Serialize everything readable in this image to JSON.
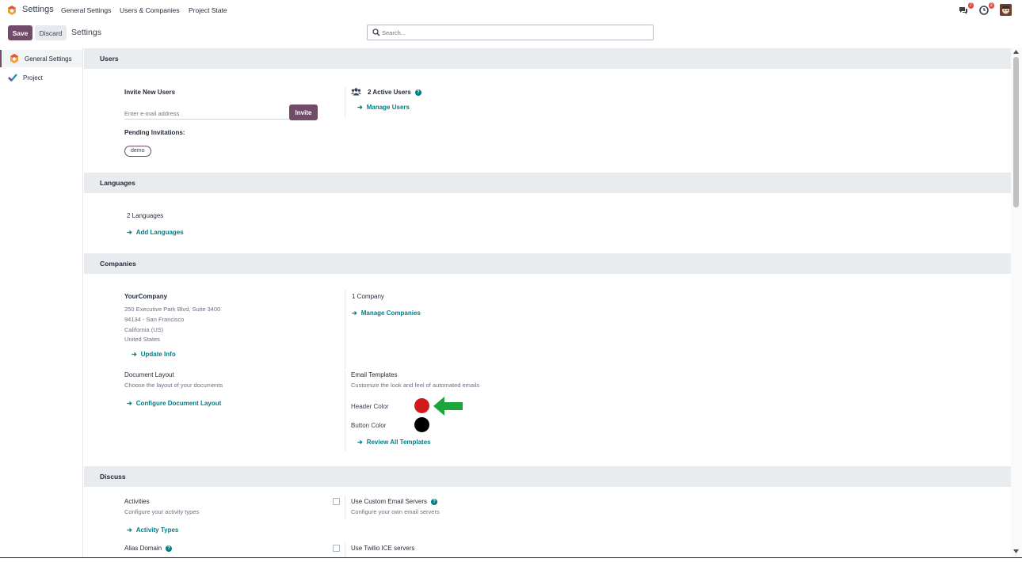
{
  "topbar": {
    "app_title": "Settings",
    "menu": [
      "General Settings",
      "Users & Companies",
      "Project State"
    ],
    "messages_count": "7",
    "activities_count": "2"
  },
  "control": {
    "save_label": "Save",
    "discard_label": "Discard",
    "title": "Settings",
    "search_placeholder": "Search..."
  },
  "sidebar": {
    "items": [
      {
        "label": "General Settings",
        "icon": "settings-app-icon"
      },
      {
        "label": "Project",
        "icon": "project-checkmark-icon"
      }
    ]
  },
  "users": {
    "section_title": "Users",
    "invite_title": "Invite New Users",
    "email_placeholder": "Enter e-mail address",
    "invite_label": "Invite",
    "pending_label": "Pending Invitations:",
    "pending": [
      "demo"
    ],
    "active_users": "2 Active Users",
    "manage_users": "Manage Users"
  },
  "languages": {
    "section_title": "Languages",
    "count": "2 Languages",
    "add_link": "Add Languages"
  },
  "companies": {
    "section_title": "Companies",
    "company_name": "YourCompany",
    "address_lines": [
      "250 Executive Park Blvd, Suite 3400",
      "94134 - San Francisco",
      "California (US)",
      "United States"
    ],
    "update_info": "Update Info",
    "company_count": "1 Company",
    "manage_companies": "Manage Companies",
    "doc_layout_title": "Document Layout",
    "doc_layout_desc": "Choose the layout of your documents",
    "configure_layout": "Configure Document Layout",
    "email_templates_title": "Email Templates",
    "email_templates_desc": "Customize the look and feel of automated emails",
    "header_color_label": "Header Color",
    "header_color": "#d11a1a",
    "button_color_label": "Button Color",
    "button_color": "#000000",
    "review_templates": "Review All Templates"
  },
  "discuss": {
    "section_title": "Discuss",
    "activities_title": "Activities",
    "activities_desc": "Configure your activity types",
    "activity_types": "Activity Types",
    "alias_domain": "Alias Domain",
    "custom_email_title": "Use Custom Email Servers",
    "custom_email_desc": "Configure your own email servers",
    "twilio_title": "Use Twilio ICE servers"
  },
  "colors": {
    "brand": "#714B67",
    "link": "#017e84",
    "arrow": "#1aa63a"
  }
}
